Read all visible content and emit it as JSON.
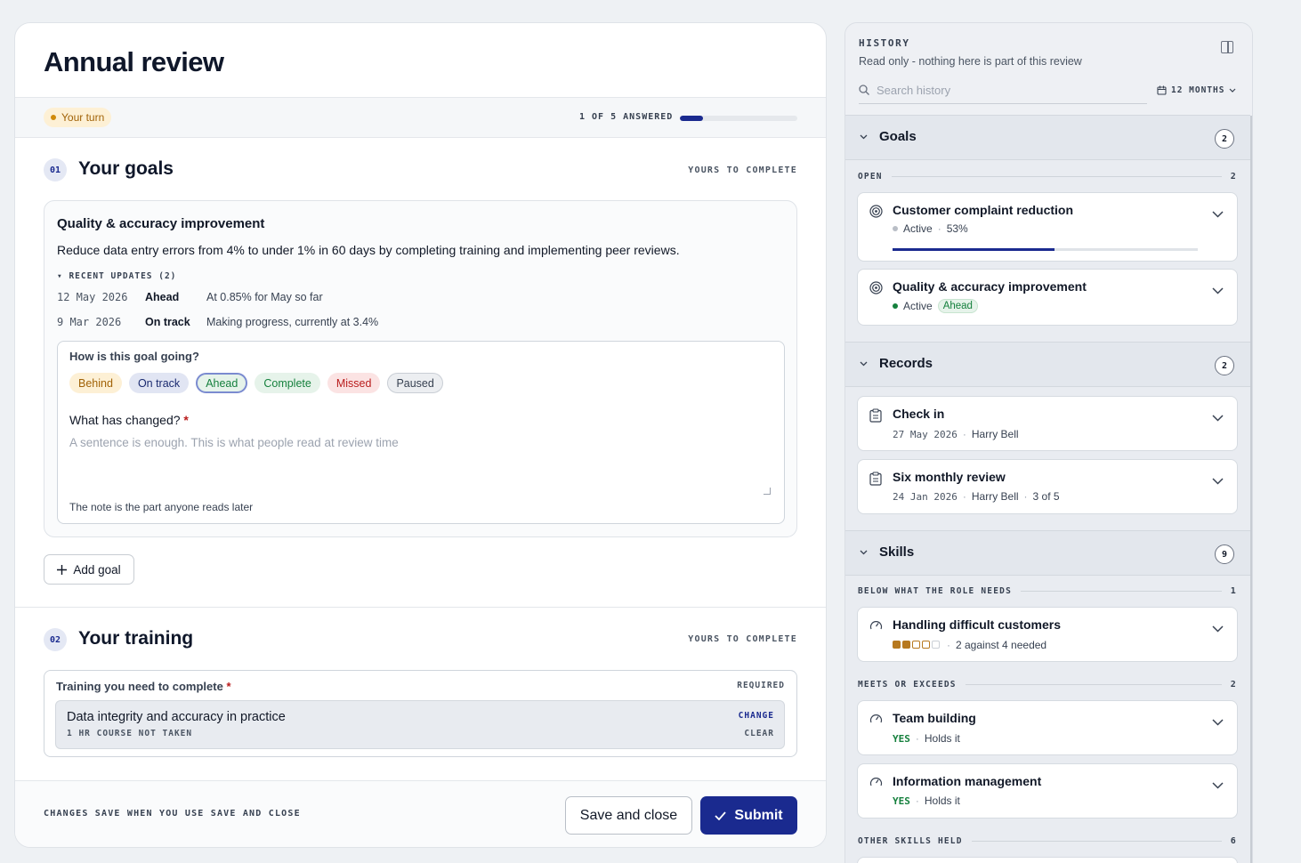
{
  "page": {
    "title": "Annual review"
  },
  "status": {
    "turn_label": "Your turn",
    "progress_label": "1 OF 5 ANSWERED",
    "progress_fraction": 0.2
  },
  "goals_section": {
    "number": "01",
    "title": "Your goals",
    "tag": "YOURS TO COMPLETE",
    "goal": {
      "title": "Quality & accuracy improvement",
      "description": "Reduce data entry errors from 4% to under 1% in 60 days by completing training and implementing peer reviews.",
      "updates_heading": "▾ RECENT UPDATES (2)",
      "updates": [
        {
          "date": "12 May 2026",
          "status": "Ahead",
          "note": "At 0.85% for May so far"
        },
        {
          "date": "9 Mar 2026",
          "status": "On track",
          "note": "Making progress, currently at 3.4%"
        }
      ],
      "question": "How is this goal going?",
      "chips": [
        "Behind",
        "On track",
        "Ahead",
        "Complete",
        "Missed",
        "Paused"
      ],
      "selected_chip": "Ahead",
      "change_label": "What has changed?",
      "required_mark": "*",
      "textarea_placeholder": "A sentence is enough. This is what people read at review time",
      "hint": "The note is the part anyone reads later"
    },
    "add_goal_label": "Add goal"
  },
  "training_section": {
    "number": "02",
    "title": "Your training",
    "tag": "YOURS TO COMPLETE",
    "field_label": "Training you need to complete",
    "required_mark": "*",
    "required_tag": "REQUIRED",
    "item": {
      "name": "Data integrity and accuracy in practice",
      "meta": "1 HR COURSE  NOT TAKEN",
      "change": "CHANGE",
      "clear": "CLEAR"
    }
  },
  "footer": {
    "note": "CHANGES SAVE WHEN YOU USE SAVE AND CLOSE",
    "save_label": "Save and close",
    "submit_label": "Submit"
  },
  "history": {
    "title": "HISTORY",
    "subtitle": "Read only - nothing here is part of this review",
    "search_placeholder": "Search history",
    "range": "12 MONTHS",
    "groups": {
      "goals": {
        "name": "Goals",
        "count": "2",
        "sub": "OPEN",
        "sub_count": "2",
        "items": [
          {
            "title": "Customer complaint reduction",
            "status": "Active",
            "percent": "53%",
            "progress": 0.53
          },
          {
            "title": "Quality & accuracy improvement",
            "status": "Active",
            "badge": "Ahead"
          }
        ]
      },
      "records": {
        "name": "Records",
        "count": "2",
        "items": [
          {
            "title": "Check in",
            "date": "27 May 2026",
            "person": "Harry Bell"
          },
          {
            "title": "Six monthly review",
            "date": "24 Jan 2026",
            "person": "Harry Bell",
            "extra": "3 of 5"
          }
        ]
      },
      "skills": {
        "name": "Skills",
        "count": "9",
        "below": {
          "label": "BELOW WHAT THE ROLE NEEDS",
          "count": "1",
          "item": {
            "title": "Handling difficult customers",
            "level": 2,
            "of": 5,
            "text": "2 against 4 needed"
          }
        },
        "meets": {
          "label": "MEETS OR EXCEEDS",
          "count": "2",
          "items": [
            {
              "title": "Team building",
              "yes": "YES",
              "text": "Holds it"
            },
            {
              "title": "Information management",
              "yes": "YES",
              "text": "Holds it"
            }
          ]
        },
        "other": {
          "label": "OTHER SKILLS HELD",
          "count": "6"
        }
      }
    }
  },
  "colors": {
    "accent": "#1a2a8f",
    "ahead": "#15803d",
    "behind": "#a16207",
    "missed": "#b91c1c"
  }
}
